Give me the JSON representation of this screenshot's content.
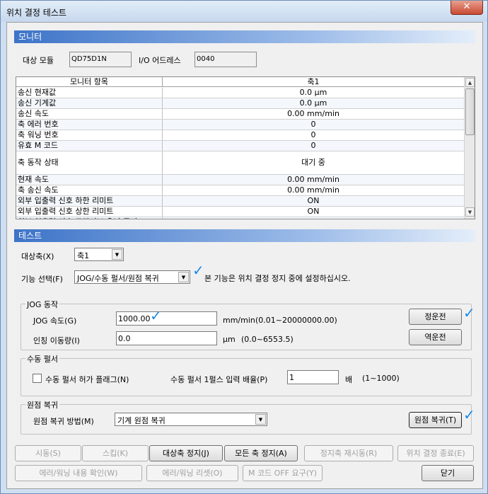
{
  "window": {
    "title": "위치 결정 테스트",
    "close_glyph": "✕"
  },
  "monitor": {
    "section_title": "모니터",
    "target_module_label": "대상 모듈",
    "target_module_value": "QD75D1N",
    "io_address_label": "I/O 어드레스",
    "io_address_value": "0040",
    "grid": {
      "header_item": "모니터 항목",
      "header_axis": "축1",
      "rows": [
        {
          "label": "송신 현재값",
          "value": "0.0 μm"
        },
        {
          "label": "송신 기계값",
          "value": "0.0 μm"
        },
        {
          "label": "송신 속도",
          "value": "0.00 mm/min"
        },
        {
          "label": "축 에러 번호",
          "value": "0"
        },
        {
          "label": "축 워닝 번호",
          "value": "0"
        },
        {
          "label": "유효 M 코드",
          "value": "0"
        },
        {
          "label": "축 동작 상태",
          "value": "대기 중"
        },
        {
          "label": "현재 속도",
          "value": "0.00 mm/min"
        },
        {
          "label": "축 송신 속도",
          "value": "0.00 mm/min"
        },
        {
          "label": "외부 입출력 신호 하한 리미트",
          "value": "ON"
        },
        {
          "label": "외부 입출력 신호 상한 리미트",
          "value": "ON"
        },
        {
          "label": "외부 입출력 신호 드라이브 유닛 준비",
          "value": "ON"
        }
      ]
    }
  },
  "test": {
    "section_title": "테스트",
    "target_axis_label": "대상축(X)",
    "target_axis_value": "축1",
    "function_label": "기능 선택(F)",
    "function_value": "JOG/수동 펄서/원점 복귀",
    "function_note": "본 기능은 위치 결정 정지 중에 설정하십시오.",
    "jog": {
      "group_title": "JOG 동작",
      "speed_label": "JOG 속도(G)",
      "speed_value": "1000.00",
      "speed_unit": "mm/min",
      "speed_range": "(0.01~20000000.00)",
      "inching_label": "인칭 이동량(I)",
      "inching_value": "0.0",
      "inching_unit": "μm",
      "inching_range": "(0.0~6553.5)",
      "forward_button": "정운전",
      "reverse_button": "역운전"
    },
    "pulser": {
      "group_title": "수동 펄서",
      "enable_flag_label": "수동 펄서 허가 플래그(N)",
      "enable_flag_checked": false,
      "magnification_label": "수동 펄서 1펄스 입력 배율(P)",
      "magnification_value": "1",
      "magnification_unit": "배",
      "magnification_range": "(1~1000)"
    },
    "home": {
      "group_title": "원점 복귀",
      "method_label": "원점 복귀 방법(M)",
      "method_value": "기계 원점 복귀",
      "home_button": "원점 복귀(T)"
    }
  },
  "bottom_buttons": {
    "start": "시동(S)",
    "skip": "스킵(K)",
    "target_axis_stop": "대상축 정지(J)",
    "all_axis_stop": "모든 축 정지(A)",
    "restart_stopped_axis": "정지축 재시동(R)",
    "end_positioning": "위치 결정 종료(E)",
    "check_error_warning": "에러/워닝 내용 확인(W)",
    "reset_error_warning": "에러/워닝 리셋(O)",
    "m_code_off": "M 코드 OFF 요구(Y)",
    "close": "닫기"
  },
  "colors": {
    "section_header": "#3d74c8",
    "check_mark": "#1a8ae6",
    "window_frame": "#cfdff1"
  },
  "icons": {
    "combo_dropdown": "chevron-down-icon",
    "check": "checkmark-icon"
  }
}
